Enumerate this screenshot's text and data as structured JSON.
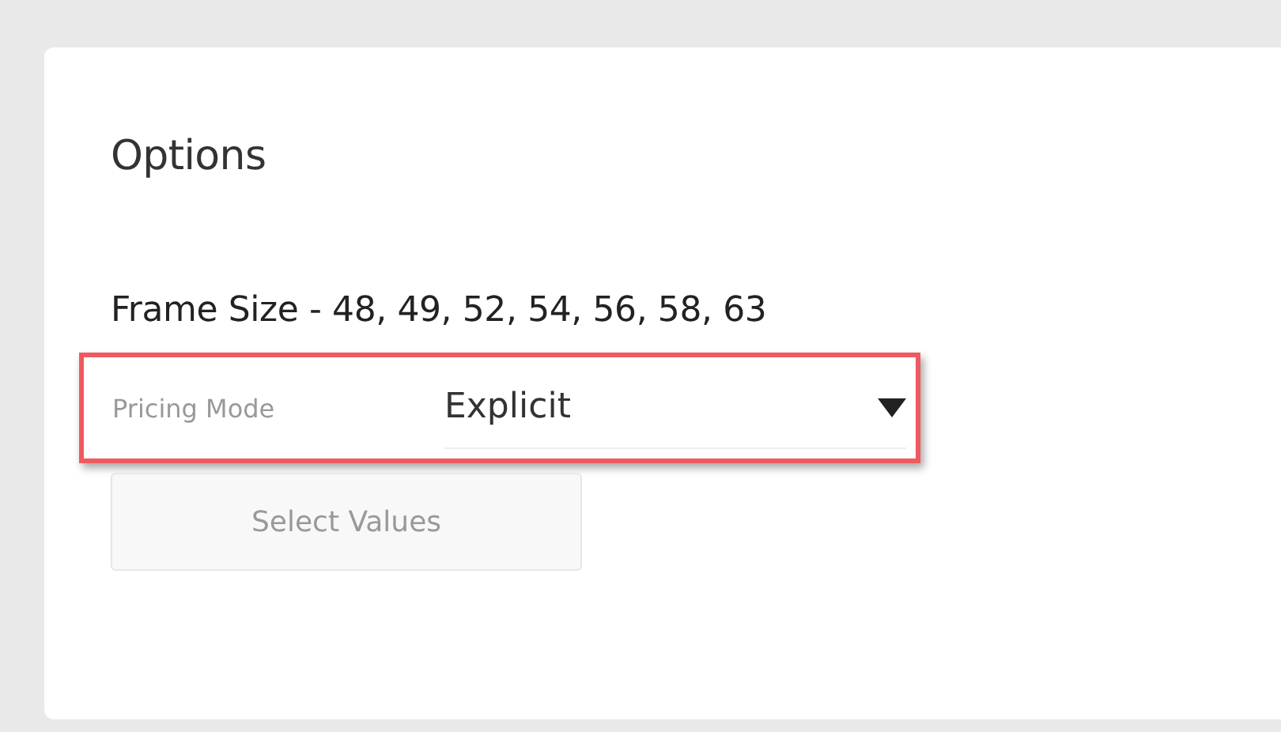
{
  "panel": {
    "title": "Options"
  },
  "option": {
    "label": "Frame Size - 48, 49, 52, 54, 56, 58, 63"
  },
  "pricing_mode": {
    "label": "Pricing Mode",
    "value": "Explicit",
    "highlighted": true
  },
  "buttons": [
    {
      "label": "Select Values",
      "disabled": true
    }
  ]
}
